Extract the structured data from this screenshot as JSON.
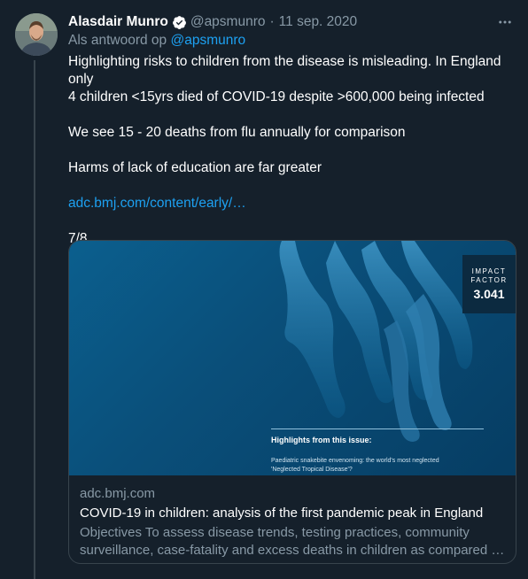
{
  "tweet": {
    "display_name": "Alasdair Munro",
    "handle": "@apsmunro",
    "separator": "·",
    "date": "11 sep. 2020",
    "more_label": "•••",
    "reply_prefix": "Als antwoord op",
    "reply_to": "@apsmunro",
    "text": {
      "line1": "Highlighting risks to children from the disease is misleading. In England only",
      "line2": "4 children <15yrs died of COVID-19 despite >600,000 being infected",
      "line3": "We see 15 - 20 deaths from flu annually for comparison",
      "line4": "Harms of lack of education are far greater",
      "link": "adc.bmj.com/content/early/…",
      "counter": "7/8"
    }
  },
  "card": {
    "image": {
      "impact_label_1": "IMPACT",
      "impact_label_2": "FACTOR",
      "impact_value": "3.041",
      "highlights_title": "Highlights from this issue:",
      "highlights_line1": "Paediatric snakebite envenoming: the world's most neglected",
      "highlights_line2": "'Neglected Tropical Disease'?"
    },
    "domain": "adc.bmj.com",
    "title": "COVID-19 in children: analysis of the first pandemic peak in England",
    "description_line1": "Objectives To assess disease trends, testing practices, community",
    "description_line2": "surveillance, case-fatality and excess deaths in children as compared …"
  },
  "colors": {
    "background": "#15202b",
    "text_primary": "#ffffff",
    "text_secondary": "#8899a6",
    "link": "#1da1f2",
    "border": "#38444d",
    "verified_badge": "#ffffff"
  },
  "icons": {
    "verified": "verified-badge-icon",
    "more": "more-options-icon"
  }
}
